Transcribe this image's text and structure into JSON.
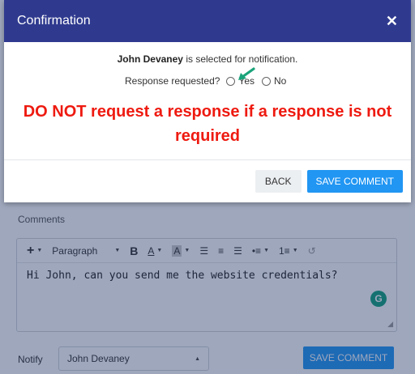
{
  "modal": {
    "title": "Confirmation",
    "close_glyph": "✕",
    "selected_name": "John Devaney",
    "selected_suffix": " is selected for notification.",
    "response_label": "Response requested?",
    "option_yes": "Yes",
    "option_no": "No",
    "response_selected": null,
    "warning_line1": "DO NOT request a response if a response is not",
    "warning_line2": "required",
    "back_label": "BACK",
    "save_label": "SAVE COMMENT"
  },
  "background": {
    "comments_label": "Comments",
    "toolbar": {
      "paragraph_label": "Paragraph",
      "items": [
        "add",
        "paragraph",
        "bold",
        "font-color",
        "highlight",
        "align-left",
        "align-center",
        "align-right",
        "bullet-list",
        "numbered-list",
        "history"
      ]
    },
    "editor_text": "Hi John, can you send me the website credentials?",
    "grammarly_badge": "G",
    "notify_label": "Notify",
    "notify_value": "John Devaney",
    "save_label": "SAVE COMMENT"
  },
  "colors": {
    "header": "#2f3a8f",
    "primary": "#2196f3",
    "warning": "#ee1a10",
    "arrow": "#1aa37a",
    "grammarly": "#14a37f"
  }
}
